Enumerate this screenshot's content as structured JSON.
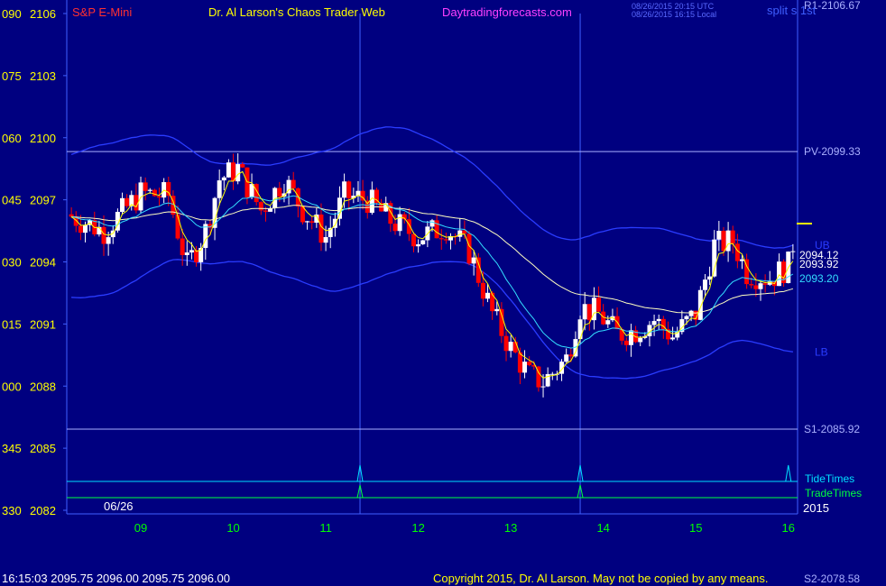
{
  "header": {
    "instrument": "S&P E-Mini",
    "site_title": "Dr. Al Larson's Chaos Trader Web",
    "site_url": "Daytradingforecasts.com",
    "timestamp_utc": "08/26/2015 20:15 UTC",
    "timestamp_local": "08/26/2015 16:15 Local",
    "split": "split s 1st"
  },
  "footer": {
    "quote": "16:15:03  2095.75  2096.00  2095.75  2096.00",
    "copyright": "Copyright 2015, Dr. Al Larson. May not be copied by any means."
  },
  "date_label": "06/26",
  "year_label": "2015",
  "colors": {
    "background": "#000080",
    "axis": "#3f5fff",
    "up_candle": "#ffffff",
    "down_candle": "#ff0000",
    "band": "#2a3cff",
    "ma_fast": "#ffff00",
    "ma_mid": "#33ddff",
    "ma_slow": "#ffffc0",
    "tide": "#00e0ff",
    "trade": "#00ff40",
    "level": "#aab0ff"
  },
  "chart_data": {
    "type": "candlestick",
    "title": "S&P E-Mini",
    "ylim": [
      2082,
      2106
    ],
    "y_ticks": [
      {
        "value": 2106,
        "left": "090",
        "right": "2106"
      },
      {
        "value": 2103,
        "left": "075",
        "right": "2103"
      },
      {
        "value": 2100,
        "left": "060",
        "right": "2100"
      },
      {
        "value": 2097,
        "left": "045",
        "right": "2097"
      },
      {
        "value": 2094,
        "left": "030",
        "right": "2094"
      },
      {
        "value": 2091,
        "left": "015",
        "right": "2091"
      },
      {
        "value": 2088,
        "left": "000",
        "right": "2088"
      },
      {
        "value": 2085,
        "left": "345",
        "right": "2085"
      },
      {
        "value": 2082,
        "left": "330",
        "right": "2082"
      }
    ],
    "xlim": [
      8.2,
      16.1
    ],
    "x_ticks": [
      "09",
      "10",
      "11",
      "12",
      "13",
      "14",
      "15",
      "16"
    ],
    "vertical_markers": [
      11.37,
      13.75
    ],
    "levels": [
      {
        "label": "R1-2106.67",
        "value": 2106.67
      },
      {
        "label": "PV-2099.33",
        "value": 2099.33
      },
      {
        "label": "S1-2085.92",
        "value": 2085.92
      },
      {
        "label": "S2-2078.58",
        "value": 2078.58
      }
    ],
    "band_labels": {
      "upper": "UB",
      "lower": "LB"
    },
    "last_price_labels": [
      "2094.12",
      "2093.92",
      "2093.20"
    ],
    "timing_lines": {
      "tide": "TideTimes",
      "trade": "TradeTimes"
    },
    "timing_spikes": [
      11.37,
      13.75,
      16.0
    ],
    "anchors": [
      [
        8.2,
        2096.3
      ],
      [
        8.6,
        2095.5
      ],
      [
        9.0,
        2097.3
      ],
      [
        9.3,
        2097.2
      ],
      [
        9.5,
        2093.8
      ],
      [
        9.7,
        2095.5
      ],
      [
        9.85,
        2098.0
      ],
      [
        10.05,
        2098.5
      ],
      [
        10.3,
        2096.5
      ],
      [
        10.55,
        2098.0
      ],
      [
        10.75,
        2096.5
      ],
      [
        11.0,
        2095.2
      ],
      [
        11.2,
        2097.2
      ],
      [
        11.45,
        2097.0
      ],
      [
        11.7,
        2096.0
      ],
      [
        12.0,
        2095.2
      ],
      [
        12.3,
        2095.7
      ],
      [
        12.55,
        2094.5
      ],
      [
        12.8,
        2091.5
      ],
      [
        13.0,
        2089.8
      ],
      [
        13.2,
        2088.5
      ],
      [
        13.35,
        2088.2
      ],
      [
        13.6,
        2089.3
      ],
      [
        13.75,
        2091.8
      ],
      [
        13.95,
        2091.5
      ],
      [
        14.15,
        2090.5
      ],
      [
        14.35,
        2090.7
      ],
      [
        14.55,
        2091.2
      ],
      [
        14.75,
        2090.4
      ],
      [
        15.0,
        2091.5
      ],
      [
        15.2,
        2094.8
      ],
      [
        15.4,
        2095.0
      ],
      [
        15.55,
        2093.5
      ],
      [
        15.8,
        2093.2
      ],
      [
        16.0,
        2093.8
      ],
      [
        16.1,
        2096.0
      ]
    ]
  }
}
